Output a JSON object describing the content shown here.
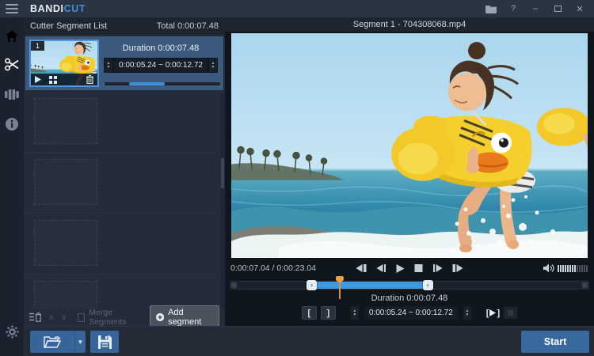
{
  "titlebar": {
    "logo_primary": "BANDI",
    "logo_accent": "CUT",
    "help_label": "?"
  },
  "sidebar": {
    "items": [
      {
        "name": "home",
        "icon": "home-icon",
        "active": false
      },
      {
        "name": "cut",
        "icon": "scissors-icon",
        "active": true
      },
      {
        "name": "join",
        "icon": "join-clips-icon",
        "active": false
      },
      {
        "name": "info",
        "icon": "info-icon",
        "active": false
      }
    ],
    "settings_icon": "gear-icon"
  },
  "segment_panel": {
    "header_title": "Cutter Segment List",
    "total_label": "Total 0:00:07.48",
    "segment": {
      "badge": "1",
      "duration_label": "Duration 0:00:07.48",
      "range_value": "0:00:05.24 ~ 0:00:12.72",
      "progress": {
        "left_pct": 21,
        "width_pct": 31
      }
    },
    "merge_label": "Merge Segments",
    "add_segment_label": "Add segment"
  },
  "video_panel": {
    "title": "Segment 1 - 704308068.mp4",
    "time_display": "0:00:07.04 / 0:00:23.04",
    "duration_label": "Duration 0:00:07.48",
    "range_value": "0:00:05.24 ~ 0:00:12.72",
    "set_start_label": "[",
    "set_end_label": "]",
    "play_segment_open": "[",
    "play_segment_close": "]",
    "timeline": {
      "sel_left_pct": 22.7,
      "sel_width_pct": 32.5,
      "playhead_left_pct": 30.6
    },
    "volume": {
      "lit": 8,
      "total": 13
    }
  },
  "bottom_bar": {
    "start_label": "Start"
  },
  "colors": {
    "accent_blue": "#3e8ed6",
    "selected_row_blue": "#3b5a7d",
    "button_blue": "#38699e",
    "playhead_orange": "#f0a13a"
  }
}
